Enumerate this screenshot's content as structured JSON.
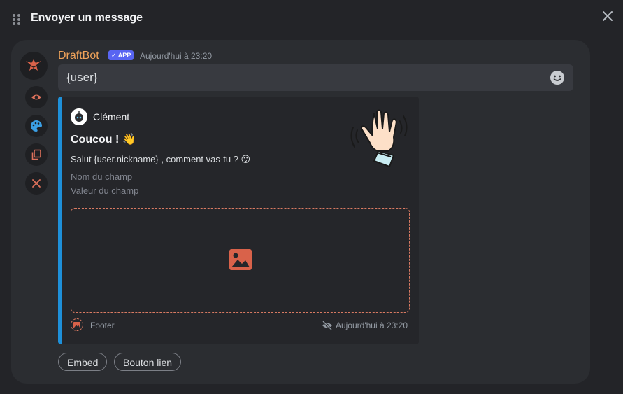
{
  "modal": {
    "title": "Envoyer un message"
  },
  "message": {
    "author": "DraftBot",
    "badge": "✓ APP",
    "timestamp": "Aujourd'hui à 23:20",
    "content": "{user}"
  },
  "embed": {
    "color": "#1e90d9",
    "author_name": "Clément",
    "title": "Coucou ! 👋",
    "description": "Salut {user.nickname} , comment vas-tu ? 😛",
    "field_name": "Nom du champ",
    "field_value": "Valeur du champ",
    "footer_text": "Footer",
    "footer_timestamp": "Aujourd'hui à 23:20"
  },
  "buttons": {
    "embed": "Embed",
    "link_button": "Bouton lien"
  },
  "side_actions": [
    "eye-icon",
    "palette-icon",
    "copy-icon",
    "close-icon"
  ],
  "icons": {
    "drag": "drag-handle-icon",
    "close": "close-icon",
    "emoji": "emoji-icon",
    "image": "image-icon"
  }
}
